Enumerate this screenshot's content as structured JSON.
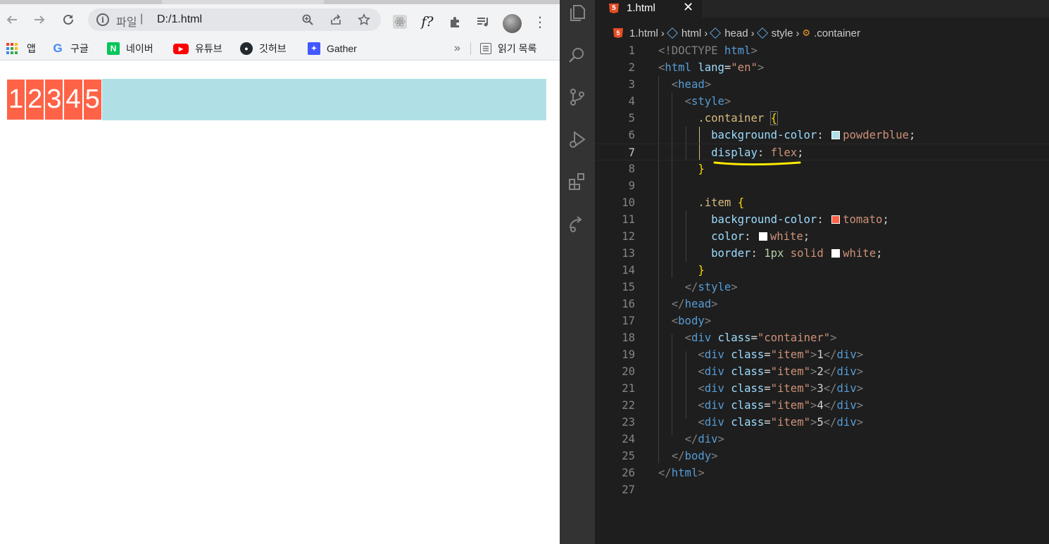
{
  "browser": {
    "address": {
      "scheme": "파일",
      "url": "D:/1.html"
    },
    "bookmarks": [
      {
        "label": "앱",
        "icon": "apps-grid-icon"
      },
      {
        "label": "구글",
        "icon": "google-icon"
      },
      {
        "label": "네이버",
        "icon": "naver-icon"
      },
      {
        "label": "유튜브",
        "icon": "youtube-icon"
      },
      {
        "label": "깃허브",
        "icon": "github-icon"
      },
      {
        "label": "Gather",
        "icon": "gather-icon"
      }
    ],
    "more_bookmarks": "»",
    "reading_list": "읽기 목록",
    "page": {
      "items": [
        "1",
        "2",
        "3",
        "4",
        "5"
      ],
      "container_color": "#b0e0e6",
      "item_color": "#ff6347"
    }
  },
  "editor": {
    "tab": {
      "title": "1.html"
    },
    "breadcrumb": [
      "1.html",
      "html",
      "head",
      "style",
      ".container"
    ],
    "active_line": 7,
    "line_numbers": [
      "1",
      "2",
      "3",
      "4",
      "5",
      "6",
      "7",
      "8",
      "9",
      "10",
      "11",
      "12",
      "13",
      "14",
      "15",
      "16",
      "17",
      "18",
      "19",
      "20",
      "21",
      "22",
      "23",
      "24",
      "25",
      "26",
      "27"
    ],
    "code": {
      "l1": [
        "<!DOCTYPE",
        "html",
        ">"
      ],
      "l2": [
        "<",
        "html",
        "lang",
        "=",
        "\"en\"",
        ">"
      ],
      "l3": [
        "<",
        "head",
        ">"
      ],
      "l4": [
        "<",
        "style",
        ">"
      ],
      "l5": [
        ".container",
        "{"
      ],
      "l6": [
        "background-color",
        ":",
        "powderblue",
        ";"
      ],
      "l7": [
        "display",
        ":",
        "flex",
        ";"
      ],
      "l8": [
        "}"
      ],
      "l10": [
        ".item",
        "{"
      ],
      "l11": [
        "background-color",
        ":",
        "tomato",
        ";"
      ],
      "l12": [
        "color",
        ":",
        "white",
        ";"
      ],
      "l13": [
        "border",
        ":",
        "1px",
        "solid",
        "white",
        ";"
      ],
      "l14": [
        "}"
      ],
      "l15": [
        "</",
        "style",
        ">"
      ],
      "l16": [
        "</",
        "head",
        ">"
      ],
      "l17": [
        "<",
        "body",
        ">"
      ],
      "l18": [
        "<",
        "div",
        "class",
        "=",
        "\"container\"",
        ">"
      ],
      "l19": [
        "<",
        "div",
        "class",
        "=",
        "\"item\"",
        ">",
        "1",
        "</",
        "div",
        ">"
      ],
      "l20": [
        "<",
        "div",
        "class",
        "=",
        "\"item\"",
        ">",
        "2",
        "</",
        "div",
        ">"
      ],
      "l21": [
        "<",
        "div",
        "class",
        "=",
        "\"item\"",
        ">",
        "3",
        "</",
        "div",
        ">"
      ],
      "l22": [
        "<",
        "div",
        "class",
        "=",
        "\"item\"",
        ">",
        "4",
        "</",
        "div",
        ">"
      ],
      "l23": [
        "<",
        "div",
        "class",
        "=",
        "\"item\"",
        ">",
        "5",
        "</",
        "div",
        ">"
      ],
      "l24": [
        "</",
        "div",
        ">"
      ],
      "l25": [
        "</",
        "body",
        ">"
      ],
      "l26": [
        "</",
        "html",
        ">"
      ]
    },
    "colors": {
      "powderblue": "#b0e0e6",
      "tomato": "#ff6347",
      "white": "#ffffff",
      "highlight_underline": "#ffea00"
    }
  }
}
